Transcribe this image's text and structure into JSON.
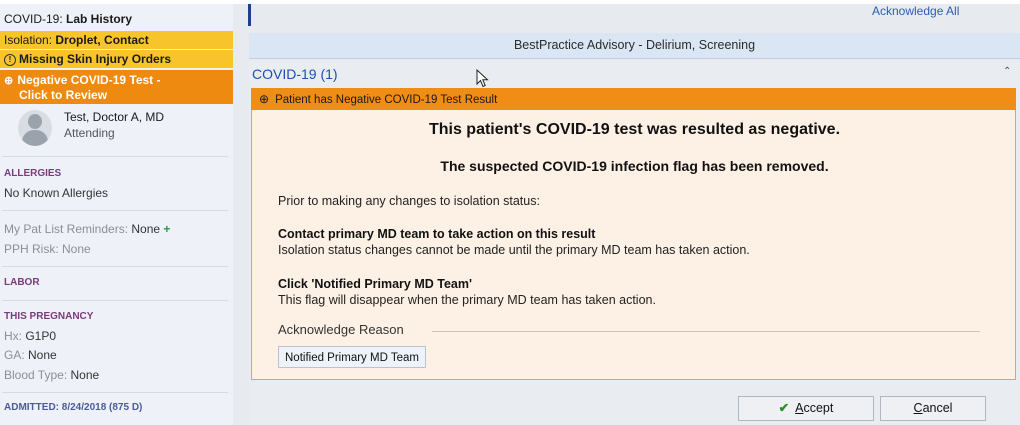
{
  "sidebar": {
    "title_prefix": "COVID-19: ",
    "title_bold": "Lab History",
    "isolation_label": "Isolation: ",
    "isolation_value": "Droplet, Contact",
    "skin_injury": "Missing Skin Injury Orders",
    "covid_alert_line1": "Negative COVID-19 Test -",
    "covid_alert_line2": "Click to Review",
    "provider_name": "Test, Doctor A, MD",
    "provider_role": "Attending",
    "allergies_header": "ALLERGIES",
    "allergies_value": "No Known Allergies",
    "reminders_label": "My Pat List Reminders: ",
    "reminders_value": "None",
    "pph_label": "PPH Risk: ",
    "pph_value": "None",
    "labor_header": "LABOR",
    "pregnancy_header": "THIS PREGNANCY",
    "hx_label": "Hx: ",
    "hx_value": "G1P0",
    "ga_label": "GA: ",
    "ga_value": "None",
    "blood_label": "Blood Type: ",
    "blood_value": "None",
    "admitted": "ADMITTED: 8/24/2018 (875 D)"
  },
  "header": {
    "acknowledge_all": "Acknowledge All",
    "bpa_title": "BestPractice Advisory - Delirium, Screening"
  },
  "advisory": {
    "section_title": "COVID-19 (1)",
    "banner": "Patient has Negative COVID-19 Test Result",
    "headline": "This patient's COVID-19 test was resulted as negative.",
    "subheadline": "The suspected COVID-19 infection flag has been removed.",
    "prior_text": "Prior to making any changes to isolation status:",
    "contact_title": "Contact primary MD team to take action on this result",
    "contact_body": "Isolation status changes cannot be made until the primary MD team has taken action.",
    "click_title": "Click 'Notified Primary MD Team'",
    "click_body": "This flag will disappear when the primary MD team has taken action.",
    "ack_reason_label": "Acknowledge Reason",
    "ack_option": "Notified Primary MD Team"
  },
  "buttons": {
    "accept_hotkey": "A",
    "accept_rest": "ccept",
    "cancel_hotkey": "C",
    "cancel_rest": "ancel"
  },
  "icons": [
    "warning-circle-icon",
    "covid-crosshair-icon",
    "avatar-icon",
    "plus-icon",
    "collapse-chevron-icon",
    "checkmark-icon",
    "mouse-cursor-icon"
  ],
  "colors": {
    "isolation_banner": "#f7c52b",
    "covid_alert": "#ef8a10",
    "link_blue": "#2a5db0",
    "section_title_blue": "#1b4fb0"
  }
}
